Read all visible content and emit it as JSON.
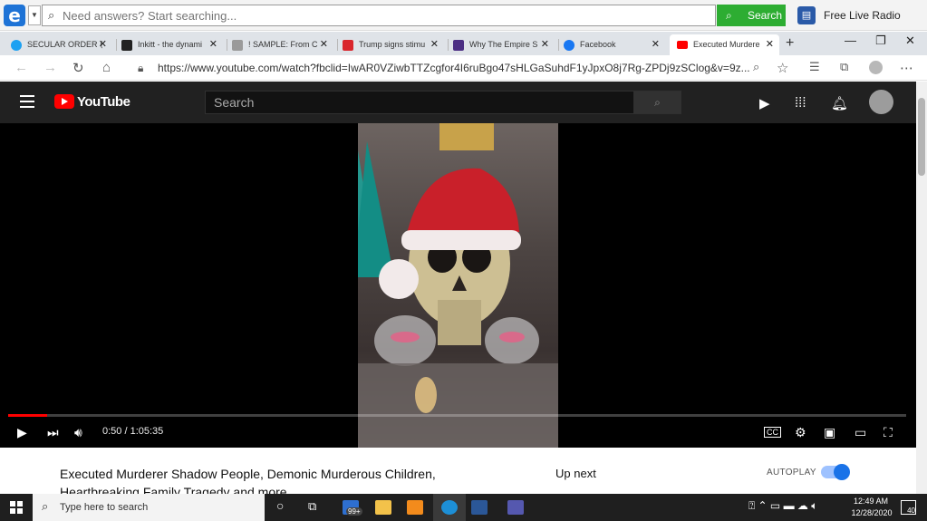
{
  "toolbar": {
    "search_placeholder": "Need answers? Start searching...",
    "search_button": "Search",
    "radio_label": "Free Live Radio"
  },
  "tabs": [
    {
      "label": "SECULAR ORDER ⟨",
      "icon": "twitter-icon",
      "color": "#1da1f2"
    },
    {
      "label": "Inkitt - the dynami",
      "icon": "inkitt-icon",
      "color": "#222222"
    },
    {
      "label": "! SAMPLE: From C",
      "icon": "page-icon",
      "color": "#9a9a9a"
    },
    {
      "label": "Trump signs stimu",
      "icon": "news-icon",
      "color": "#d9262c"
    },
    {
      "label": "Why The Empire S",
      "icon": "site-icon",
      "color": "#4b2e83"
    },
    {
      "label": "Facebook",
      "icon": "facebook-icon",
      "color": "#1877f2"
    },
    {
      "label": "Executed Murdere",
      "icon": "youtube-icon",
      "color": "#ff0000"
    }
  ],
  "address": {
    "url": "https://www.youtube.com/watch?fbclid=IwAR0VZiwbTTZcgfor4I6ruBgo47sHLGaSuhdF1yJpxO8j7Rg-ZPDj9zSClog&v=9z..."
  },
  "youtube": {
    "wordmark": "YouTube",
    "search_placeholder": "Search"
  },
  "player": {
    "time": "0:50 / 1:05:35",
    "progress": 0.0127
  },
  "video": {
    "title": "Executed Murderer Shadow People, Demonic Murderous Children, Heartbreaking Family Tragedy and more.",
    "up_next": "Up next",
    "autoplay": "AUTOPLAY"
  },
  "taskbar": {
    "search_placeholder": "Type here to search",
    "mail_badge": "99+",
    "time": "12:49 AM",
    "date": "12/28/2020",
    "notifications": "40"
  }
}
